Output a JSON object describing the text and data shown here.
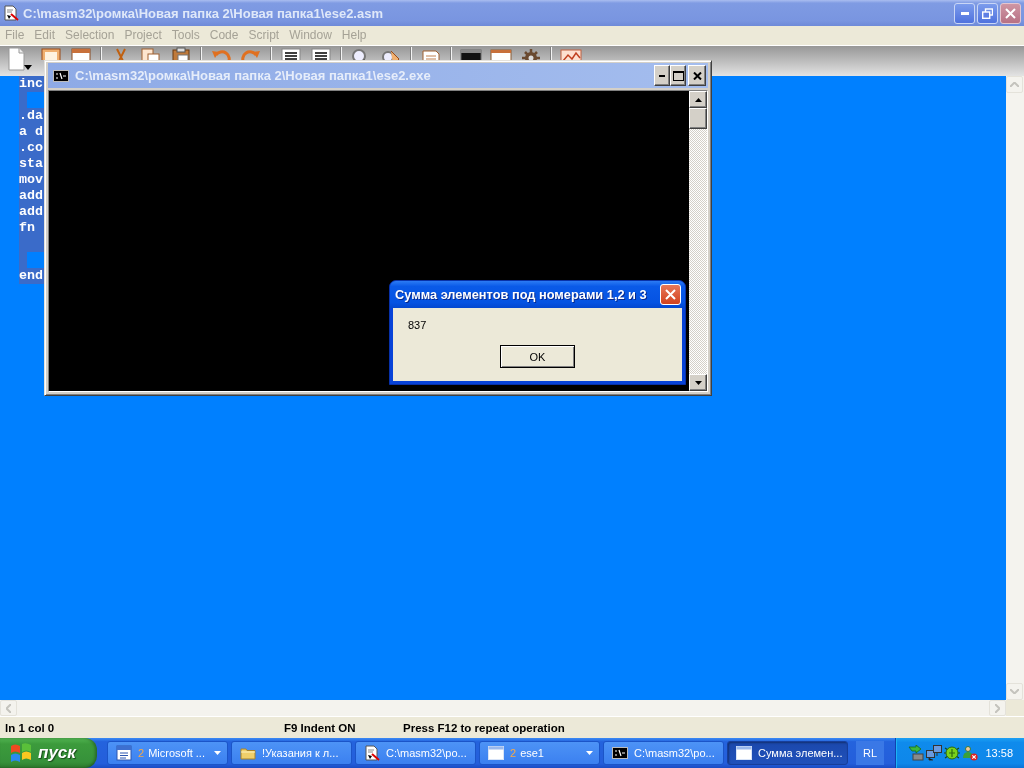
{
  "editor_window": {
    "title": "C:\\masm32\\ромка\\Новая папка 2\\Новая папка1\\ese2.asm",
    "menu": [
      {
        "label": "File",
        "disabled": true
      },
      {
        "label": "Edit",
        "disabled": true
      },
      {
        "label": "Selection",
        "disabled": true
      },
      {
        "label": "Project",
        "disabled": true
      },
      {
        "label": "Tools",
        "disabled": true
      },
      {
        "label": "Code",
        "disabled": true
      },
      {
        "label": "Script",
        "disabled": true
      },
      {
        "label": "Window",
        "disabled": true
      },
      {
        "label": "Help",
        "disabled": true
      }
    ],
    "lines": [
      {
        "kind": "text",
        "text": "inc",
        "selected": true
      },
      {
        "kind": "empty",
        "selected": true
      },
      {
        "kind": "text",
        "text": ".da",
        "selected": true
      },
      {
        "kind": "text",
        "text": "a d",
        "selected": true
      },
      {
        "kind": "text",
        "text": ".co",
        "selected": true
      },
      {
        "kind": "text",
        "text": "sta",
        "selected": true
      },
      {
        "kind": "text",
        "text": "mov",
        "selected": true
      },
      {
        "kind": "text",
        "text": "add",
        "selected": true
      },
      {
        "kind": "text",
        "text": "add",
        "selected": true
      },
      {
        "kind": "text",
        "text": "fn",
        "selected": true
      },
      {
        "kind": "whitespace",
        "selected": true
      },
      {
        "kind": "empty",
        "selected": true
      },
      {
        "kind": "text",
        "text": "end",
        "selected": true
      }
    ],
    "status_bar": [
      "ln 1 col 0",
      "F9 Indent ON",
      "Press F12 to repeat operation"
    ]
  },
  "console_window": {
    "title": "C:\\masm32\\ромка\\Новая папка 2\\Новая папка1\\ese2.exe"
  },
  "message_box": {
    "title": "Сумма элементов под номерами 1,2 и 3",
    "message": "837",
    "buttons": [
      "OK"
    ]
  },
  "taskbar": {
    "start_label": "пуск",
    "buttons": [
      {
        "kind": "word",
        "count": "2",
        "label": "Microsoft ...",
        "selected": false
      },
      {
        "kind": "folder",
        "label": "!Указания к л...",
        "selected": false
      },
      {
        "kind": "editor",
        "label": "C:\\masm32\\ро...",
        "selected": false
      },
      {
        "kind": "window",
        "count": "2",
        "label": "ese1",
        "selected": false
      },
      {
        "kind": "console",
        "label": "C:\\masm32\\ро...",
        "selected": false
      },
      {
        "kind": "window",
        "label": "Сумма элемен...",
        "selected": true
      }
    ],
    "language": "RL",
    "clock": "13:58"
  }
}
